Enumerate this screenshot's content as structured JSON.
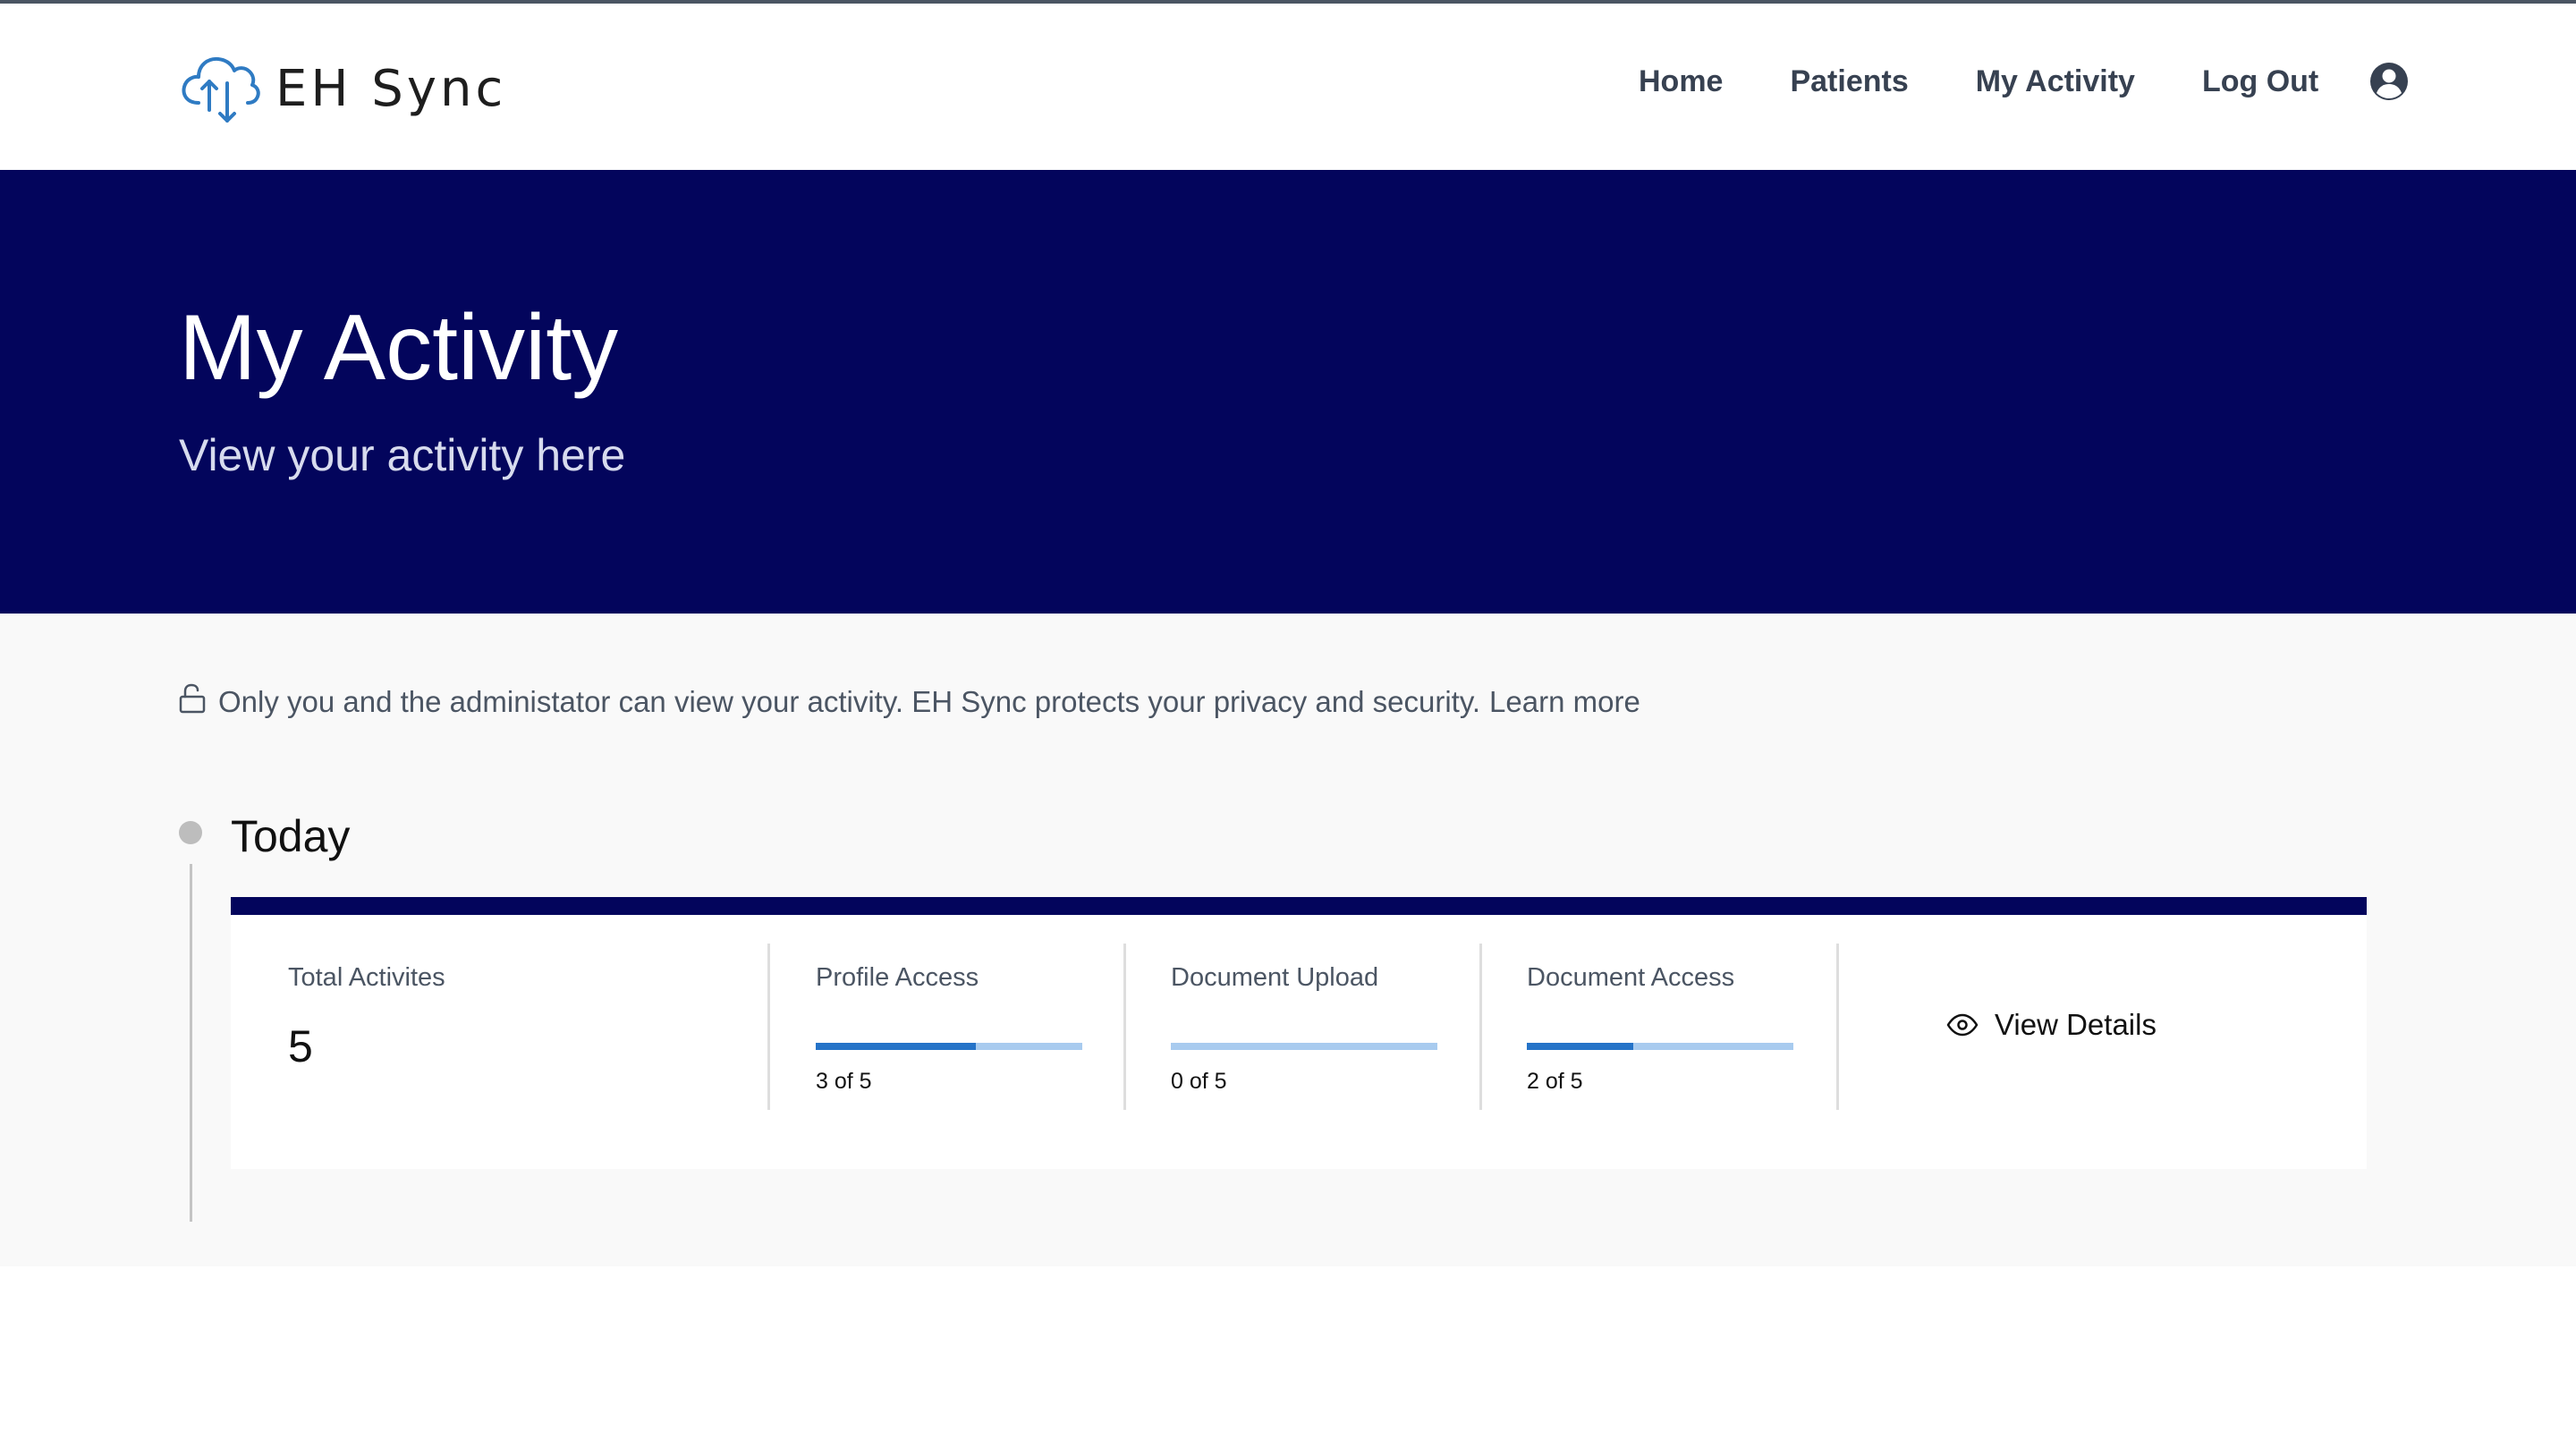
{
  "app": {
    "brand_name": "EH Sync",
    "logo_icon": "cloud-sync-icon"
  },
  "nav": {
    "items": [
      {
        "label": "Home"
      },
      {
        "label": "Patients"
      },
      {
        "label": "My Activity"
      },
      {
        "label": "Log Out"
      }
    ],
    "account_icon": "user-circle-icon"
  },
  "hero": {
    "title": "My Activity",
    "subtitle": "View your activity here"
  },
  "privacy": {
    "icon": "lock-open-icon",
    "text": "Only you and the administator can view your activity. EH Sync protects your privacy and security.",
    "link_label": "Learn more"
  },
  "timeline": {
    "day_label": "Today",
    "summary": {
      "total_label": "Total Activites",
      "total_value": "5",
      "stats": [
        {
          "label": "Profile Access",
          "count": 3,
          "max": 5,
          "text": "3 of 5"
        },
        {
          "label": "Document Upload",
          "count": 0,
          "max": 5,
          "text": "0 of 5"
        },
        {
          "label": "Document Access",
          "count": 2,
          "max": 5,
          "text": "2 of 5"
        }
      ],
      "details_label": "View Details",
      "details_icon": "eye-icon"
    }
  },
  "colors": {
    "hero_background": "#03055c",
    "progress_fill": "#2573c8",
    "progress_track": "#a8cbef",
    "content_background": "#f9f9f9"
  }
}
